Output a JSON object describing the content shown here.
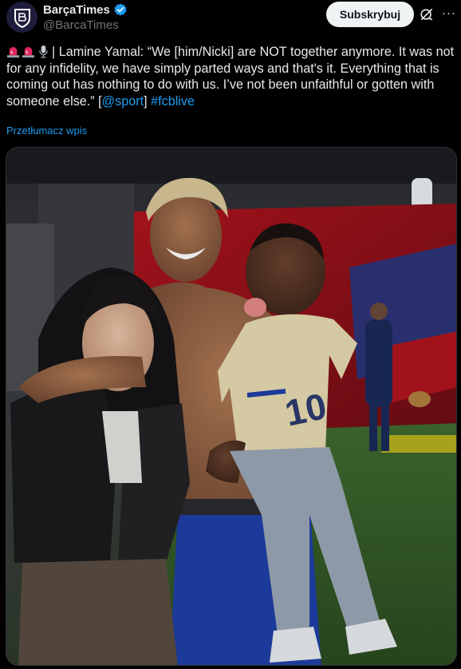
{
  "account": {
    "display_name": "BarçaTimes",
    "handle": "@BarcaTimes",
    "avatar_icon": "barca-times-logo-icon",
    "verified_icon": "verified-badge-icon",
    "brand_color": "#1f1d3d"
  },
  "actions": {
    "subscribe_label": "Subskrybuj",
    "grok_icon": "grok-icon",
    "more_label": "···"
  },
  "tweet": {
    "emoji_icons": [
      "rotating-light-icon",
      "rotating-light-icon",
      "microphone-icon"
    ],
    "text_main": "| Lamine Yamal: “We [him/Nicki] are NOT together anymore. It was not for any infidelity, we have simply parted ways and that's it. Everything that is coming out has nothing to do with us. I’ve not been unfaithful or gotten with someone else.” [",
    "mention": "@sport",
    "text_after_mention": "] ",
    "hashtag": "#fcblive",
    "translate_label": "Przetłumacz wpis"
  },
  "media": {
    "type": "photo",
    "accent_color": "#1d9bf0"
  }
}
